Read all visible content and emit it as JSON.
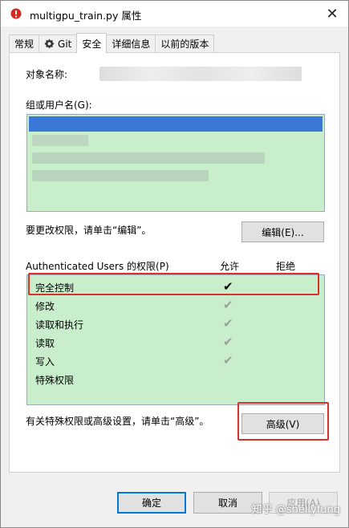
{
  "window": {
    "title": "multigpu_train.py 属性",
    "close_glyph": "✕"
  },
  "tabs": [
    {
      "label": "常规",
      "active": false
    },
    {
      "label": "Git",
      "active": false,
      "icon": "git-icon"
    },
    {
      "label": "安全",
      "active": true
    },
    {
      "label": "详细信息",
      "active": false
    },
    {
      "label": "以前的版本",
      "active": false
    }
  ],
  "security": {
    "object_name_label": "对象名称:",
    "group_users_label": "组或用户名(G):",
    "change_permission_hint": "要更改权限，请单击“编辑”。",
    "edit_button": "编辑(E)...",
    "permissions_label": "Authenticated Users 的权限(P)",
    "allow_header": "允许",
    "deny_header": "拒绝",
    "permissions": [
      {
        "name": "完全控制",
        "allow": "✔",
        "allow_style": "checked"
      },
      {
        "name": "修改",
        "allow": "✔",
        "allow_style": "inherited"
      },
      {
        "name": "读取和执行",
        "allow": "✔",
        "allow_style": "inherited"
      },
      {
        "name": "读取",
        "allow": "✔",
        "allow_style": "inherited"
      },
      {
        "name": "写入",
        "allow": "✔",
        "allow_style": "inherited"
      },
      {
        "name": "特殊权限",
        "allow": "",
        "allow_style": "none"
      }
    ],
    "advanced_hint": "有关特殊权限或高级设置，请单击“高级”。",
    "advanced_button": "高级(V)"
  },
  "footer": {
    "ok_button": "确定",
    "cancel_button": "取消",
    "apply_button": "应用(A)"
  },
  "watermark": "知乎 @shellyfung",
  "colors": {
    "list_bg": "#c8eecc",
    "selection": "#3a78d8",
    "highlight_box": "#d9312b",
    "default_button_border": "#0078d7"
  }
}
